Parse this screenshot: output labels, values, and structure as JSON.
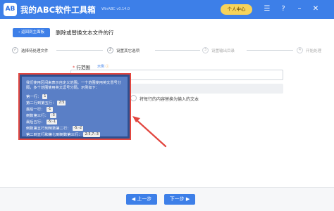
{
  "app": {
    "logo_text": "AB",
    "title": "我的ABC软件工具箱",
    "version": "WinABC v0.14.0",
    "user_center": "个人中心"
  },
  "header": {
    "back_label": "返回到主面板",
    "page_title": "删除或替换文本文件的行"
  },
  "steps": [
    {
      "number": "✓",
      "label": "选择待处理文件"
    },
    {
      "number": "2",
      "label": "设置其它选项"
    },
    {
      "number": "3",
      "label": "设置输出目录"
    },
    {
      "number": "4",
      "label": "开始处理"
    }
  ],
  "form": {
    "field_label": "行范围",
    "required_mark": "*",
    "example_link": "示例",
    "radio_label": "将每行的内容替换为输入的文本"
  },
  "tooltip": {
    "intro": "我们使用区间来表示自定义范围。一个范围使用英文冒号分隔，多个范围使用英文逗号分隔。示例如下：",
    "rows": [
      {
        "label": "第一行：",
        "value": "1"
      },
      {
        "label": "第二行到第五行：",
        "value": "2:5"
      },
      {
        "label": "最后一行：",
        "value": "-1"
      },
      {
        "label": "倒数第三行：",
        "value": "-3"
      },
      {
        "label": "最后五行：",
        "value": "-5:-1"
      },
      {
        "label": "倒数第五行到倒数第二行：",
        "value": "-5:-2"
      },
      {
        "label": "第二到五行和第七到倒数第三行：",
        "value": "2:5,7:-3"
      }
    ]
  },
  "buttons": {
    "prev": "上一步",
    "next": "下一步"
  },
  "colors": {
    "primary": "#3d7fe8",
    "tooltip_bg": "#5a7fc6",
    "highlight_red": "#e2463f",
    "user_center_bg": "#f7d35a"
  }
}
